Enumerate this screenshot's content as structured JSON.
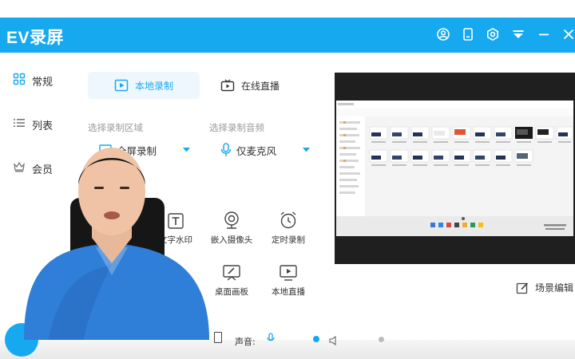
{
  "app": {
    "title": "EV录屏"
  },
  "sidebar": {
    "items": [
      {
        "label": "常规",
        "icon": "grid-icon"
      },
      {
        "label": "列表",
        "icon": "list-icon"
      },
      {
        "label": "会员",
        "icon": "crown-icon"
      }
    ]
  },
  "tabs": [
    {
      "label": "本地录制",
      "icon": "video-file-icon",
      "active": true
    },
    {
      "label": "在线直播",
      "icon": "tv-icon",
      "active": false
    }
  ],
  "settings": {
    "area_label": "选择录制区域",
    "area_value": "全屏录制",
    "audio_label": "选择录制音频",
    "audio_value": "仅麦克风"
  },
  "tools": [
    {
      "label": "文字水印",
      "icon": "text-watermark-icon"
    },
    {
      "label": "嵌入摄像头",
      "icon": "webcam-icon"
    },
    {
      "label": "定时录制",
      "icon": "alarm-clock-icon"
    },
    {
      "label": "桌面画板",
      "icon": "whiteboard-icon"
    },
    {
      "label": "本地直播",
      "icon": "local-live-icon"
    }
  ],
  "preview": {
    "scene_edit_label": "场景编辑"
  },
  "bottom": {
    "volume_label": "声音:"
  },
  "colors": {
    "accent": "#17a9f0",
    "title_bar": "#17a9f0",
    "shirt": "#2f7fd8"
  }
}
